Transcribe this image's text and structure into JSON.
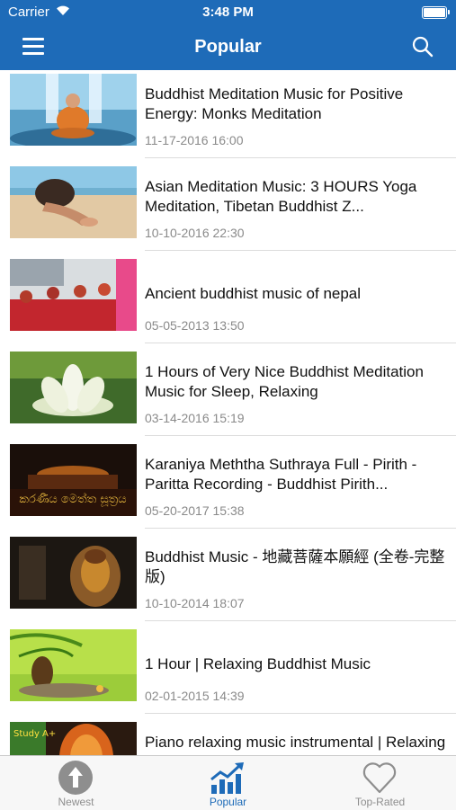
{
  "status": {
    "carrier": "Carrier",
    "time": "3:48 PM"
  },
  "nav": {
    "title": "Popular"
  },
  "videos": [
    {
      "title": "Buddhist Meditation Music for Positive Energy: Monks Meditation",
      "date": "11-17-2016 16:00",
      "thumb": "meditating-monk-waterfall"
    },
    {
      "title": "Asian Meditation Music: 3 HOURS Yoga Meditation, Tibetan Buddhist Z...",
      "date": "10-10-2016 22:30",
      "thumb": "yoga-beach"
    },
    {
      "title": "Ancient buddhist music of nepal",
      "date": "05-05-2013 13:50",
      "thumb": "monks-red-robes"
    },
    {
      "title": "1 Hours of Very Nice Buddhist Meditation Music for Sleep, Relaxing",
      "date": "03-14-2016 15:19",
      "thumb": "white-lotus"
    },
    {
      "title": "Karaniya Meththa Suthraya Full - Pirith - Paritta Recording - Buddhist Pirith...",
      "date": "05-20-2017 15:38",
      "thumb": "sinhala-title-temple",
      "thumb_text": "කරණීය මෙත්ත සූත්‍රය"
    },
    {
      "title": "Buddhist Music - 地藏菩薩本願經 (全卷-完整版)",
      "date": "10-10-2014 18:07",
      "thumb": "golden-buddha"
    },
    {
      "title": "1 Hour | Relaxing Buddhist Music",
      "date": "02-01-2015 14:39",
      "thumb": "buddha-bamboo"
    },
    {
      "title": "Piano relaxing music instrumental | Relaxing music for study, meditat...",
      "date": "",
      "thumb": "study-candle",
      "thumb_text": "Study A+"
    }
  ],
  "tabs": [
    {
      "label": "Newest",
      "icon": "up-arrow-circle-icon",
      "active": false
    },
    {
      "label": "Popular",
      "icon": "trending-chart-icon",
      "active": true
    },
    {
      "label": "Top-Rated",
      "icon": "heart-icon",
      "active": false
    }
  ],
  "colors": {
    "accent": "#1e6bb8",
    "tab_inactive": "#8e8e8e",
    "date_text": "#8a8a8a"
  }
}
